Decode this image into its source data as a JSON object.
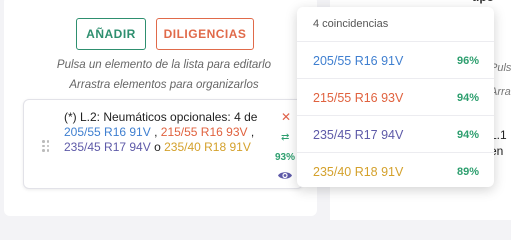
{
  "buttons": {
    "add_label": "AÑADIR",
    "diligencias_label": "DILIGENCIAS"
  },
  "hints": {
    "edit": "Pulsa un elemento de la lista para editarlo",
    "order": "Arrastra elementos para organizarlos"
  },
  "item": {
    "prefix": "(*) L.2: Neumáticos opcionales: 4 de ",
    "options": [
      {
        "text": "205/55 R16 91V",
        "color": "#3f7fd0"
      },
      {
        "text": "215/55 R16 93V",
        "color": "#e0623f"
      },
      {
        "text": "235/45 R17 94V",
        "color": "#5e5aa8"
      },
      {
        "text": "235/40 R18 91V",
        "color": "#d4a12c"
      }
    ],
    "sep1": " , ",
    "sep2": " , ",
    "conj": " o ",
    "match_percent": "93%",
    "icons": {
      "delete": "close-icon",
      "swap": "swap-arrows-icon",
      "view": "eye-icon"
    }
  },
  "dropdown": {
    "header": "4 coincidencias",
    "rows": [
      {
        "label": "205/55 R16 91V",
        "percent": "96%",
        "color": "#3f7fd0"
      },
      {
        "label": "215/55 R16 93V",
        "percent": "94%",
        "color": "#e0623f"
      },
      {
        "label": "235/45 R17 94V",
        "percent": "94%",
        "color": "#5e5aa8"
      },
      {
        "label": "235/40 R18 91V",
        "percent": "89%",
        "color": "#d4a12c"
      }
    ]
  },
  "right_panel": {
    "head_text": "tipo",
    "text1": "Pulsa",
    "text2": "Arra",
    "text3": "L.1",
    "text4": "en"
  },
  "colors": {
    "accent_green": "#2e9f6f",
    "accent_red": "#e0623f"
  }
}
